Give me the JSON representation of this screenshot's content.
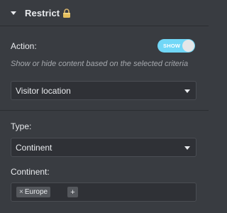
{
  "section": {
    "title": "Restrict",
    "lock_icon": "lock-icon",
    "caret_icon": "caret-down-icon"
  },
  "action": {
    "label": "Action:",
    "toggle_label": "SHOW",
    "toggle_on": true,
    "accent_color": "#71d7f7",
    "description": "Show or hide content based on the selected criteria"
  },
  "criteria_select": {
    "value": "Visitor location"
  },
  "type": {
    "label": "Type:",
    "value": "Continent"
  },
  "continent": {
    "label": "Continent:",
    "tags": [
      {
        "remove_symbol": "×",
        "label": "Europe"
      }
    ],
    "add_symbol": "+"
  }
}
